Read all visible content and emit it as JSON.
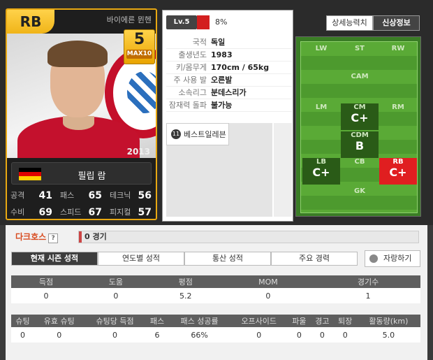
{
  "card": {
    "position": "RB",
    "club": "바이에른 뮌헨",
    "overall": "5",
    "max_label": "MAX10",
    "year": "2013",
    "name": "필립 람",
    "nationality_flag": "germany-flag",
    "stats": [
      {
        "label": "공격",
        "value": "41"
      },
      {
        "label": "패스",
        "value": "65"
      },
      {
        "label": "테크닉",
        "value": "56"
      },
      {
        "label": "수비",
        "value": "69"
      },
      {
        "label": "스피드",
        "value": "67"
      },
      {
        "label": "피지컬",
        "value": "57"
      }
    ]
  },
  "level": {
    "label": "Lv.5",
    "percent": "8%",
    "fill_fraction": 0.08
  },
  "info": [
    {
      "k": "국적",
      "v": "독일"
    },
    {
      "k": "출생년도",
      "v": "1983"
    },
    {
      "k": "키/몸무게",
      "v": "170cm / 65kg"
    },
    {
      "k": "주 사용 발",
      "v": "오른발"
    },
    {
      "k": "소속리그",
      "v": "분데스리가"
    },
    {
      "k": "잠재력 돌파",
      "v": "불가능"
    }
  ],
  "skill": {
    "icon": "11",
    "label": "베스트일레븐"
  },
  "tabs": [
    "상세능력치",
    "신상정보"
  ],
  "pitch": [
    {
      "id": "lw",
      "label": "LW",
      "grade": ""
    },
    {
      "id": "st",
      "label": "ST",
      "grade": ""
    },
    {
      "id": "rw",
      "label": "RW",
      "grade": ""
    },
    {
      "id": "cam",
      "label": "CAM",
      "grade": ""
    },
    {
      "id": "lm",
      "label": "LM",
      "grade": ""
    },
    {
      "id": "cm",
      "label": "CM",
      "grade": "C+"
    },
    {
      "id": "rm",
      "label": "RM",
      "grade": ""
    },
    {
      "id": "cdm",
      "label": "CDM",
      "grade": "B"
    },
    {
      "id": "lb",
      "label": "LB",
      "grade": "C+"
    },
    {
      "id": "cb",
      "label": "CB",
      "grade": ""
    },
    {
      "id": "rb",
      "label": "RB",
      "grade": "C+"
    },
    {
      "id": "gk",
      "label": "GK",
      "grade": ""
    }
  ],
  "darkhorse": {
    "title": "다크호스",
    "help": "?",
    "games": "0 경기"
  },
  "bottom_tabs": [
    "현재 시즌 성적",
    "연도별 성적",
    "통산 성적",
    "주요 경력"
  ],
  "share": "자랑하기",
  "table1": {
    "headers": [
      "득점",
      "도움",
      "평점",
      "MOM",
      "경기수"
    ],
    "row": [
      "0",
      "0",
      "5.2",
      "0",
      "1"
    ]
  },
  "table2": {
    "headers": [
      "슈팅",
      "유효 슈팅",
      "슈팅당 득점",
      "패스",
      "패스 성공률",
      "오프사이드",
      "파울",
      "경고",
      "퇴장",
      "활동량(km)"
    ],
    "row": [
      "0",
      "0",
      "0",
      "6",
      "66%",
      "0",
      "0",
      "0",
      "0",
      "5.0"
    ]
  }
}
